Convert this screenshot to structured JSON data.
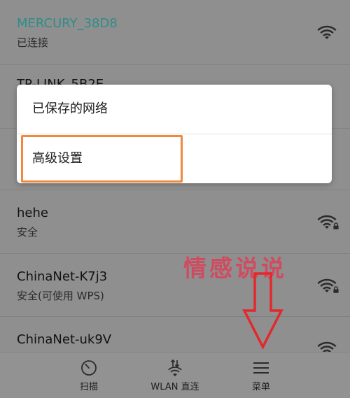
{
  "networks": [
    {
      "ssid": "MERCURY_38D8",
      "status": "已连接",
      "connected": true,
      "icon": "wifi-icon"
    },
    {
      "ssid": "TP-LINK_5B2E"
    },
    {
      "ssid": "hehe",
      "status": "安全",
      "icon": "wifi-icon",
      "lock": true,
      "lock_icon": "lock-icon"
    },
    {
      "ssid": "ChinaNet-K7j3",
      "status": "安全(可使用 WPS)",
      "icon": "wifi-icon",
      "lock": true,
      "lock_icon": "lock-icon"
    },
    {
      "ssid": "ChinaNet-uk9V",
      "icon": "wifi-icon"
    }
  ],
  "popup_menu": {
    "items": [
      {
        "label": "已保存的网络"
      },
      {
        "label": "高级设置",
        "highlighted": true
      }
    ]
  },
  "bottom_bar": {
    "items": [
      {
        "label": "扫描",
        "icon": "scan-icon"
      },
      {
        "label": "WLAN 直连",
        "icon": "wlan-direct-icon"
      },
      {
        "label": "菜单",
        "icon": "menu-icon"
      }
    ]
  },
  "annotations": {
    "watermark": "情感说说",
    "arrow_icon": "down-arrow-icon",
    "arrow_color": "#e3282e",
    "highlight_color": "#f0883d"
  },
  "colors": {
    "background": "#8f8f8f",
    "connected_ssid": "#2f8d8a",
    "text_primary": "#121212",
    "text_secondary": "#2a2a2a",
    "icon": "#2b2b2b",
    "popup_background": "#ffffff",
    "watermark": "#e23a54"
  }
}
